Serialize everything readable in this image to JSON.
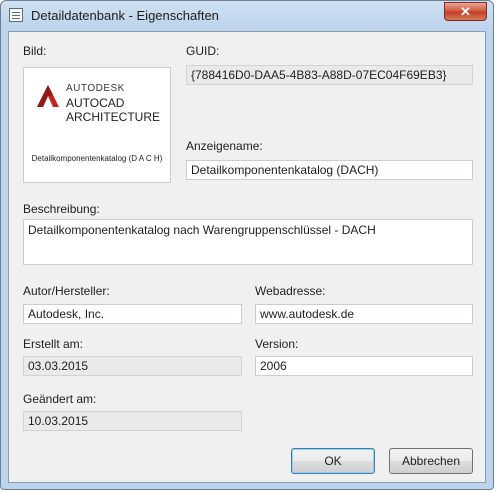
{
  "window": {
    "title": "Detaildatenbank - Eigenschaften",
    "close_glyph": "✕"
  },
  "image_section": {
    "label": "Bild:",
    "logo": {
      "brand": "AUTODESK",
      "product_line1": "AUTOCAD",
      "product_line2": "ARCHITECTURE",
      "caption": "Detailkomponentenkatalog (D A C H)",
      "icon": "autocad-a-logo-icon",
      "accent_color": "#c4241b"
    }
  },
  "guid": {
    "label": "GUID:",
    "value": "{788416D0-DAA5-4B83-A88D-07EC04F69EB3}"
  },
  "display_name": {
    "label": "Anzeigename:",
    "value": "Detailkomponentenkatalog (DACH)"
  },
  "description": {
    "label": "Beschreibung:",
    "value": "Detailkomponentenkatalog nach Warengruppenschlüssel - DACH"
  },
  "author": {
    "label": "Autor/Hersteller:",
    "value": "Autodesk, Inc."
  },
  "web_address": {
    "label": "Webadresse:",
    "value": "www.autodesk.de"
  },
  "created": {
    "label": "Erstellt am:",
    "value": "03.03.2015"
  },
  "version": {
    "label": "Version:",
    "value": "2006"
  },
  "modified": {
    "label": "Geändert am:",
    "value": "10.03.2015"
  },
  "buttons": {
    "ok": "OK",
    "cancel": "Abbrechen"
  }
}
